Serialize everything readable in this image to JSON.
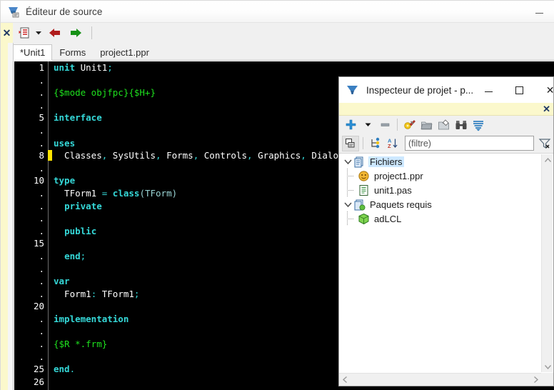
{
  "source_editor": {
    "title": "Éditeur de source",
    "title_icon": "source-editor-icon",
    "minimize_label": "",
    "close_strip_label": "✕",
    "toolbar": {
      "units_button": "units-list-icon",
      "dropdown": "chevron-down-icon",
      "back": "back-arrow-icon",
      "forward": "forward-arrow-icon"
    },
    "tabs": [
      {
        "label": "*Unit1",
        "active": true
      },
      {
        "label": "Forms",
        "active": false
      },
      {
        "label": "project1.ppr",
        "active": false
      }
    ],
    "gutter": [
      {
        "text": "1",
        "marker": false
      },
      {
        "text": ".",
        "marker": false
      },
      {
        "text": ".",
        "marker": false
      },
      {
        "text": ".",
        "marker": false
      },
      {
        "text": "5",
        "marker": false
      },
      {
        "text": ".",
        "marker": false
      },
      {
        "text": ".",
        "marker": false
      },
      {
        "text": "8",
        "marker": true
      },
      {
        "text": ".",
        "marker": false
      },
      {
        "text": "10",
        "marker": false
      },
      {
        "text": ".",
        "marker": false
      },
      {
        "text": ".",
        "marker": false
      },
      {
        "text": ".",
        "marker": false
      },
      {
        "text": ".",
        "marker": false
      },
      {
        "text": "15",
        "marker": false
      },
      {
        "text": ".",
        "marker": false
      },
      {
        "text": ".",
        "marker": false
      },
      {
        "text": ".",
        "marker": false
      },
      {
        "text": ".",
        "marker": false
      },
      {
        "text": "20",
        "marker": false
      },
      {
        "text": ".",
        "marker": false
      },
      {
        "text": ".",
        "marker": false
      },
      {
        "text": ".",
        "marker": false
      },
      {
        "text": ".",
        "marker": false
      },
      {
        "text": "25",
        "marker": false
      },
      {
        "text": "26",
        "marker": false
      }
    ],
    "code": [
      [
        {
          "t": "unit",
          "c": "kw"
        },
        {
          "t": " ",
          "c": "id"
        },
        {
          "t": "Unit1",
          "c": "id"
        },
        {
          "t": ";",
          "c": "pun"
        }
      ],
      [
        {
          "t": "",
          "c": "id"
        }
      ],
      [
        {
          "t": "{$mode objfpc}{$H+}",
          "c": "dir"
        }
      ],
      [
        {
          "t": "",
          "c": "id"
        }
      ],
      [
        {
          "t": "interface",
          "c": "kw"
        }
      ],
      [
        {
          "t": "",
          "c": "id"
        }
      ],
      [
        {
          "t": "uses",
          "c": "kw"
        }
      ],
      [
        {
          "t": "  Classes",
          "c": "id"
        },
        {
          "t": ", ",
          "c": "pun"
        },
        {
          "t": "SysUtils",
          "c": "id"
        },
        {
          "t": ", ",
          "c": "pun"
        },
        {
          "t": "Forms",
          "c": "id"
        },
        {
          "t": ", ",
          "c": "pun"
        },
        {
          "t": "Controls",
          "c": "id"
        },
        {
          "t": ", ",
          "c": "pun"
        },
        {
          "t": "Graphics",
          "c": "id"
        },
        {
          "t": ", ",
          "c": "pun"
        },
        {
          "t": "Dialogs",
          "c": "id"
        },
        {
          "t": ";",
          "c": "pun"
        }
      ],
      [
        {
          "t": "",
          "c": "id"
        }
      ],
      [
        {
          "t": "type",
          "c": "kw"
        }
      ],
      [
        {
          "t": "  TForm1 ",
          "c": "id"
        },
        {
          "t": "= ",
          "c": "pun"
        },
        {
          "t": "class",
          "c": "kw"
        },
        {
          "t": "(",
          "c": "dim"
        },
        {
          "t": "TForm",
          "c": "dim"
        },
        {
          "t": ")",
          "c": "dim"
        }
      ],
      [
        {
          "t": "  ",
          "c": "id"
        },
        {
          "t": "private",
          "c": "kw"
        }
      ],
      [
        {
          "t": "",
          "c": "id"
        }
      ],
      [
        {
          "t": "  ",
          "c": "id"
        },
        {
          "t": "public",
          "c": "kw"
        }
      ],
      [
        {
          "t": "",
          "c": "id"
        }
      ],
      [
        {
          "t": "  ",
          "c": "id"
        },
        {
          "t": "end",
          "c": "kw"
        },
        {
          "t": ";",
          "c": "pun"
        }
      ],
      [
        {
          "t": "",
          "c": "id"
        }
      ],
      [
        {
          "t": "var",
          "c": "kw"
        }
      ],
      [
        {
          "t": "  Form1",
          "c": "id"
        },
        {
          "t": ": ",
          "c": "pun"
        },
        {
          "t": "TForm1",
          "c": "id"
        },
        {
          "t": ";",
          "c": "pun"
        }
      ],
      [
        {
          "t": "",
          "c": "id"
        }
      ],
      [
        {
          "t": "implementation",
          "c": "kw"
        }
      ],
      [
        {
          "t": "",
          "c": "id"
        }
      ],
      [
        {
          "t": "{$R *.frm}",
          "c": "dir"
        }
      ],
      [
        {
          "t": "",
          "c": "id"
        }
      ],
      [
        {
          "t": "end",
          "c": "kw"
        },
        {
          "t": ".",
          "c": "pun"
        }
      ],
      [
        {
          "t": "",
          "c": "id"
        }
      ]
    ]
  },
  "project_inspector": {
    "title": "Inspecteur de projet - p...",
    "title_icon": "lazarus-icon",
    "minimize": "minimize-icon",
    "maximize": "maximize-icon",
    "close": "✕",
    "filter_strip_close": "✕",
    "toolbar1": {
      "add": "add-plus-icon",
      "add_dropdown": "chevron-down-icon",
      "remove": "remove-minus-icon",
      "options": "compiler-options-icon",
      "open": "open-folder-icon",
      "diagram": "diagram-icon",
      "find": "binoculars-icon",
      "sort_list": "list-lines-icon"
    },
    "toolbar2": {
      "view_mode": "files-view-icon",
      "tree_mode": "tree-view-icon",
      "sort_az": "sort-az-icon",
      "clear_filter": "clear-filter-icon"
    },
    "filter": {
      "placeholder": "(filtre)",
      "value": ""
    },
    "tree": [
      {
        "level": 0,
        "chevron": "v",
        "icon": "files-folder-icon",
        "label": "Fichiers",
        "selected": true
      },
      {
        "level": 1,
        "chevron": "",
        "icon": "project-ppr-icon",
        "label": "project1.ppr",
        "selected": false
      },
      {
        "level": 1,
        "chevron": "",
        "icon": "pascal-unit-icon",
        "label": "unit1.pas",
        "selected": false
      },
      {
        "level": 0,
        "chevron": "v",
        "icon": "packages-folder-icon",
        "label": "Paquets requis",
        "selected": false
      },
      {
        "level": 1,
        "chevron": "",
        "icon": "package-box-icon",
        "label": "adLCL",
        "selected": false
      }
    ],
    "scroll": {
      "up": "▲",
      "down": "▼",
      "left": "◄",
      "right": "►"
    }
  },
  "colors": {
    "editor_bg": "#000000",
    "keyword": "#35d8d8",
    "directive": "#1ee11e",
    "identifier": "#ffffff",
    "marker": "#ffe400",
    "selection": "#cde8ff",
    "yellow_strip": "#fbf8cc"
  }
}
